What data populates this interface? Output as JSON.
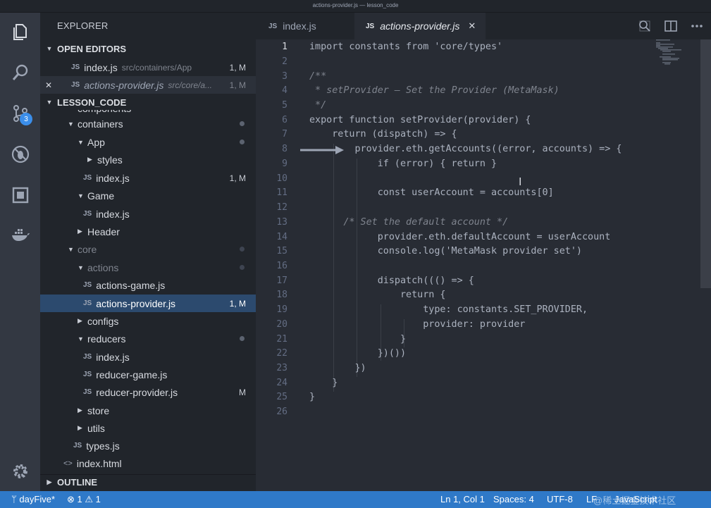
{
  "window": {
    "title": "actions-provider.js — lesson_code"
  },
  "activity": {
    "icons": [
      "explorer-icon",
      "search-icon",
      "source-control-icon",
      "debug-icon",
      "extensions-icon",
      "docker-icon",
      "settings-gear-icon"
    ],
    "scm_badge": "3"
  },
  "sidebar": {
    "header": "EXPLORER",
    "open_editors": {
      "title": "OPEN EDITORS",
      "items": [
        {
          "close": "",
          "icon": "JS",
          "name": "index.js",
          "path": "src/containers/App",
          "status": "1, M"
        },
        {
          "close": "✕",
          "icon": "JS",
          "name": "actions-provider.js",
          "path": "src/core/a...",
          "status": "1, M"
        }
      ]
    },
    "folder": {
      "title": "LESSON_CODE",
      "items": [
        {
          "label": "components"
        },
        {
          "label": "containers"
        },
        {
          "label": "App"
        },
        {
          "label": "styles"
        },
        {
          "icon": "JS",
          "label": "index.js",
          "status": "1, M"
        },
        {
          "label": "Game"
        },
        {
          "icon": "JS",
          "label": "index.js"
        },
        {
          "label": "Header"
        },
        {
          "label": "core"
        },
        {
          "label": "actions"
        },
        {
          "icon": "JS",
          "label": "actions-game.js"
        },
        {
          "icon": "JS",
          "label": "actions-provider.js",
          "status": "1, M"
        },
        {
          "label": "configs"
        },
        {
          "label": "reducers"
        },
        {
          "icon": "JS",
          "label": "index.js"
        },
        {
          "icon": "JS",
          "label": "reducer-game.js"
        },
        {
          "icon": "JS",
          "label": "reducer-provider.js",
          "status": "M"
        },
        {
          "label": "store"
        },
        {
          "label": "utils"
        },
        {
          "icon": "JS",
          "label": "types.js"
        },
        {
          "label": "index.html"
        }
      ]
    },
    "outline": "OUTLINE"
  },
  "tabs": [
    {
      "icon": "JS",
      "label": "index.js"
    },
    {
      "icon": "JS",
      "label": "actions-provider.js",
      "close": "✕"
    }
  ],
  "editor": {
    "line_numbers": [
      "1",
      "2",
      "3",
      "4",
      "5",
      "6",
      "7",
      "8",
      "9",
      "10",
      "11",
      "12",
      "13",
      "14",
      "15",
      "16",
      "17",
      "18",
      "19",
      "20",
      "21",
      "22",
      "23",
      "24",
      "25",
      "26"
    ],
    "lines": [
      "import constants from 'core/types'",
      "",
      "/**",
      " * setProvider — Set the Provider (MetaMask)",
      " */",
      "export function setProvider(provider) {",
      "    return (dispatch) => {",
      "        provider.eth.getAccounts((error, accounts) => {",
      "            if (error) { return }",
      "",
      "            const userAccount = accounts[0]",
      "",
      "      /* Set the default account */",
      "            provider.eth.defaultAccount = userAccount",
      "            console.log('MetaMask provider set')",
      "",
      "            dispatch((() => {",
      "                return {",
      "                    type: constants.SET_PROVIDER,",
      "                    provider: provider",
      "                }",
      "            })())",
      "        })",
      "    }",
      "}",
      ""
    ]
  },
  "statusbar": {
    "branch": "dayFive*",
    "errors": "1",
    "warnings": "1",
    "position": "Ln 1, Col 1",
    "spaces": "Spaces: 4",
    "encoding": "UTF-8",
    "eol": "LF",
    "language": "JavaScript",
    "watermark": "@稀土掘金技术社区"
  }
}
